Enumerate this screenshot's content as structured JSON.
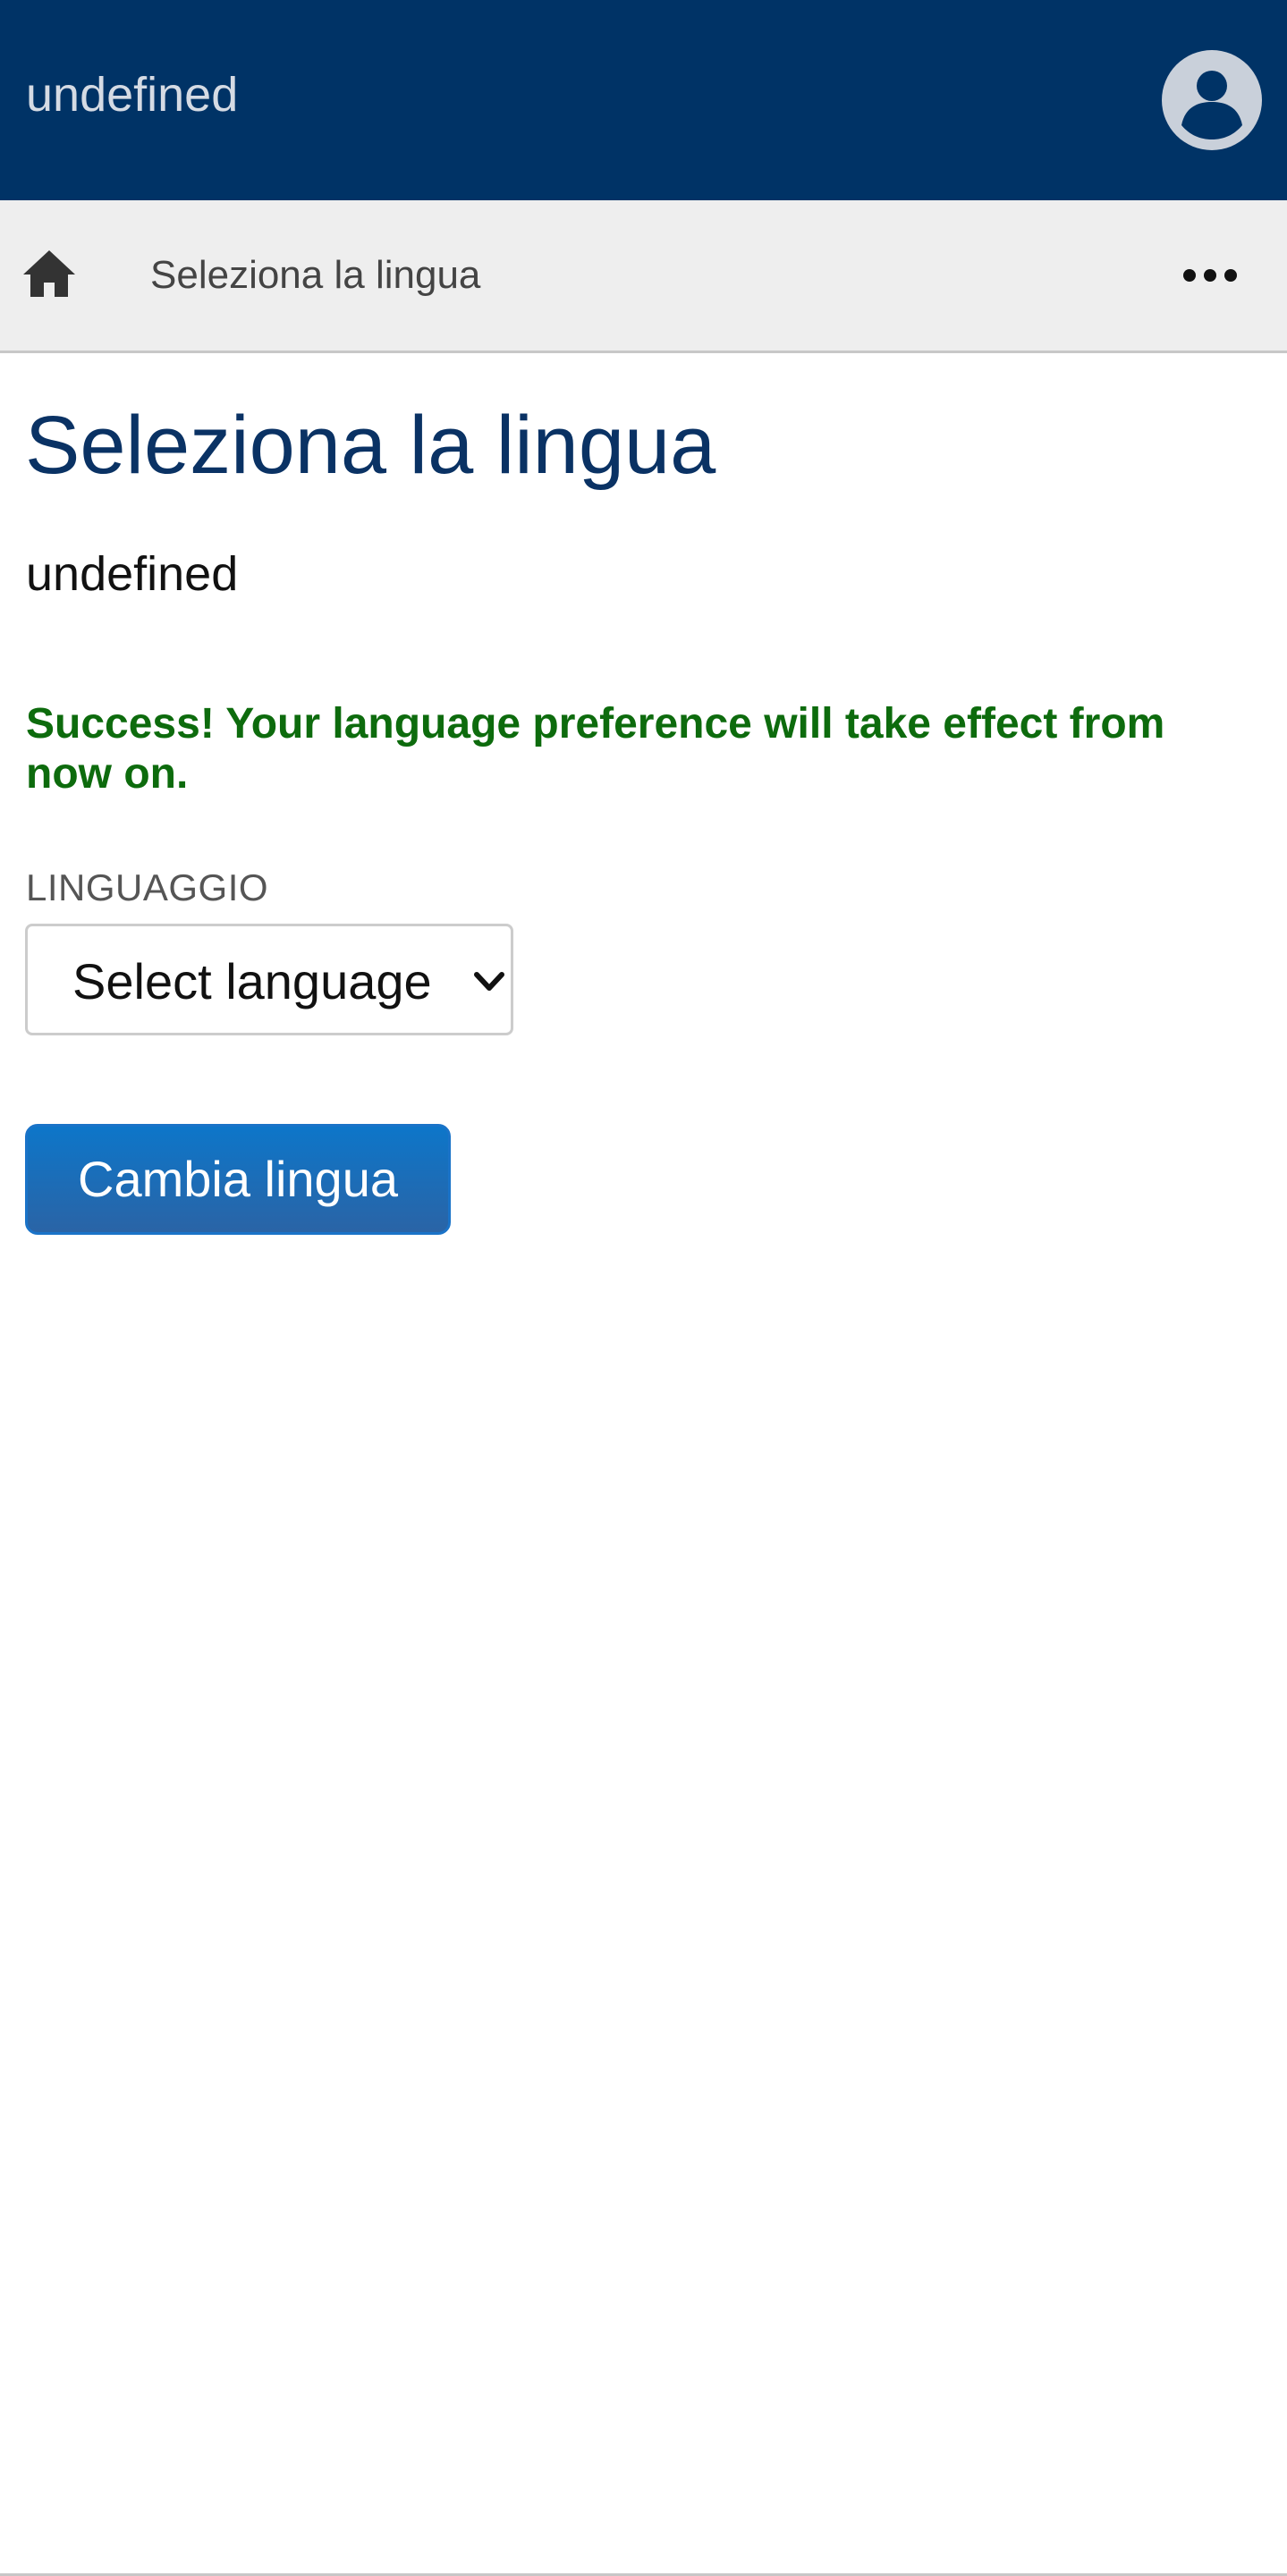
{
  "header": {
    "title": "undefined",
    "background_color": "#003366",
    "avatar_icon": "user-circle-icon"
  },
  "breadcrumb": {
    "home_icon": "home-icon",
    "current": "Seleziona la lingua",
    "more_icon": "more-horizontal-icon"
  },
  "main": {
    "title": "Seleziona la lingua",
    "subtitle": "undefined",
    "success_message": "Success! Your language preference will take effect from now on.",
    "success_color": "#0d6b0d",
    "language_field": {
      "label": "LINGUAGGIO",
      "selected": "Select language",
      "chevron_icon": "chevron-down-icon"
    },
    "submit_label": "Cambia lingua",
    "accent_color": "#0d76c9"
  }
}
